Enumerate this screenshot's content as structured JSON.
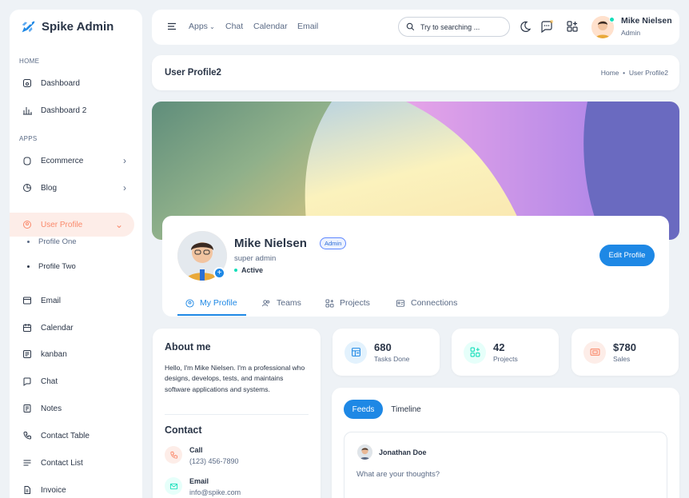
{
  "app": {
    "name": "Spike Admin",
    "brand_color": "#1e88e5",
    "accent": "#fa896b"
  },
  "sidebar": {
    "sections": [
      "Home",
      "Apps"
    ],
    "items": [
      {
        "label": "Dashboard",
        "icon": "aperture-icon"
      },
      {
        "label": "Dashboard 2",
        "icon": "chart-bar-icon"
      },
      {
        "label": "Ecommerce",
        "icon": "basket-icon"
      },
      {
        "label": "Blog",
        "icon": "chart-donut-icon"
      },
      {
        "label": "User Profile",
        "icon": "user-circle-icon"
      },
      {
        "label": "Email",
        "icon": "mail-icon"
      },
      {
        "label": "Calendar",
        "icon": "calendar-icon"
      },
      {
        "label": "kanban",
        "icon": "layout-kanban-icon"
      },
      {
        "label": "Chat",
        "icon": "message-icon"
      },
      {
        "label": "Notes",
        "icon": "notes-icon"
      },
      {
        "label": "Contact Table",
        "icon": "phone-icon"
      },
      {
        "label": "Contact List",
        "icon": "list-details-icon"
      },
      {
        "label": "Invoice",
        "icon": "file-text-icon"
      }
    ],
    "sub_items": [
      "Profile One",
      "Profile Two"
    ]
  },
  "header": {
    "nav": [
      "Apps",
      "Chat",
      "Calendar",
      "Email"
    ],
    "search_placeholder": "Try to searching ...",
    "user": {
      "name": "Mike Nielsen",
      "role": "Admin"
    }
  },
  "breadcrumb": {
    "title": "User Profile2",
    "home": "Home",
    "current": "User Profile2"
  },
  "profile": {
    "name": "Mike Nielsen",
    "badge": "Admin",
    "role": "super admin",
    "status": "Active",
    "edit_label": "Edit Profile",
    "tabs": [
      "My Profile",
      "Teams",
      "Projects",
      "Connections"
    ]
  },
  "about": {
    "title": "About me",
    "text": "Hello, I'm Mike Nielsen. I'm a professional who designs, develops, tests, and maintains software applications and systems.",
    "contact_title": "Contact",
    "contacts": [
      {
        "label": "Call",
        "value": "(123) 456-7890"
      },
      {
        "label": "Email",
        "value": "info@spike.com"
      }
    ]
  },
  "stats": [
    {
      "value": "680",
      "label": "Tasks Done",
      "color": "#1e88e5"
    },
    {
      "value": "42",
      "label": "Projects",
      "color": "#13deb9"
    },
    {
      "value": "$780",
      "label": "Sales",
      "color": "#fa896b"
    }
  ],
  "feeds": {
    "tabs": [
      "Feeds",
      "Timeline"
    ],
    "post_user": "Jonathan Doe",
    "post_placeholder": "What are your thoughts?"
  }
}
